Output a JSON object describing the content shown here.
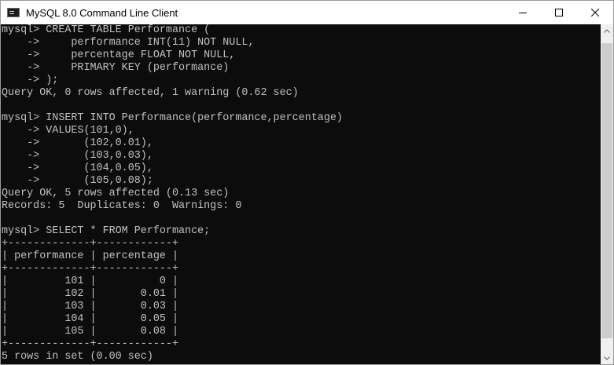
{
  "window": {
    "title": "MySQL 8.0 Command Line Client",
    "controls": {
      "minimize": "minimize",
      "maximize": "maximize",
      "close": "close"
    }
  },
  "console": {
    "lines": [
      "mysql> CREATE TABLE Performance (",
      "    ->     performance INT(11) NOT NULL,",
      "    ->     percentage FLOAT NOT NULL,",
      "    ->     PRIMARY KEY (performance)",
      "    -> );",
      "Query OK, 0 rows affected, 1 warning (0.62 sec)",
      "",
      "mysql> INSERT INTO Performance(performance,percentage)",
      "    -> VALUES(101,0),",
      "    ->       (102,0.01),",
      "    ->       (103,0.03),",
      "    ->       (104,0.05),",
      "    ->       (105,0.08);",
      "Query OK, 5 rows affected (0.13 sec)",
      "Records: 5  Duplicates: 0  Warnings: 0",
      "",
      "mysql> SELECT * FROM Performance;",
      "+-------------+------------+",
      "| performance | percentage |",
      "+-------------+------------+",
      "|         101 |          0 |",
      "|         102 |       0.01 |",
      "|         103 |       0.03 |",
      "|         104 |       0.05 |",
      "|         105 |       0.08 |",
      "+-------------+------------+",
      "5 rows in set (0.00 sec)"
    ]
  },
  "colors": {
    "console_bg": "#0c0c0c",
    "console_fg": "#c0c0c0",
    "titlebar_bg": "#ffffff"
  },
  "icons": {
    "app": "console-app-icon",
    "minimize": "minimize-icon",
    "maximize": "maximize-icon",
    "close": "close-icon",
    "scroll_up": "chevron-up-icon",
    "scroll_down": "chevron-down-icon"
  }
}
